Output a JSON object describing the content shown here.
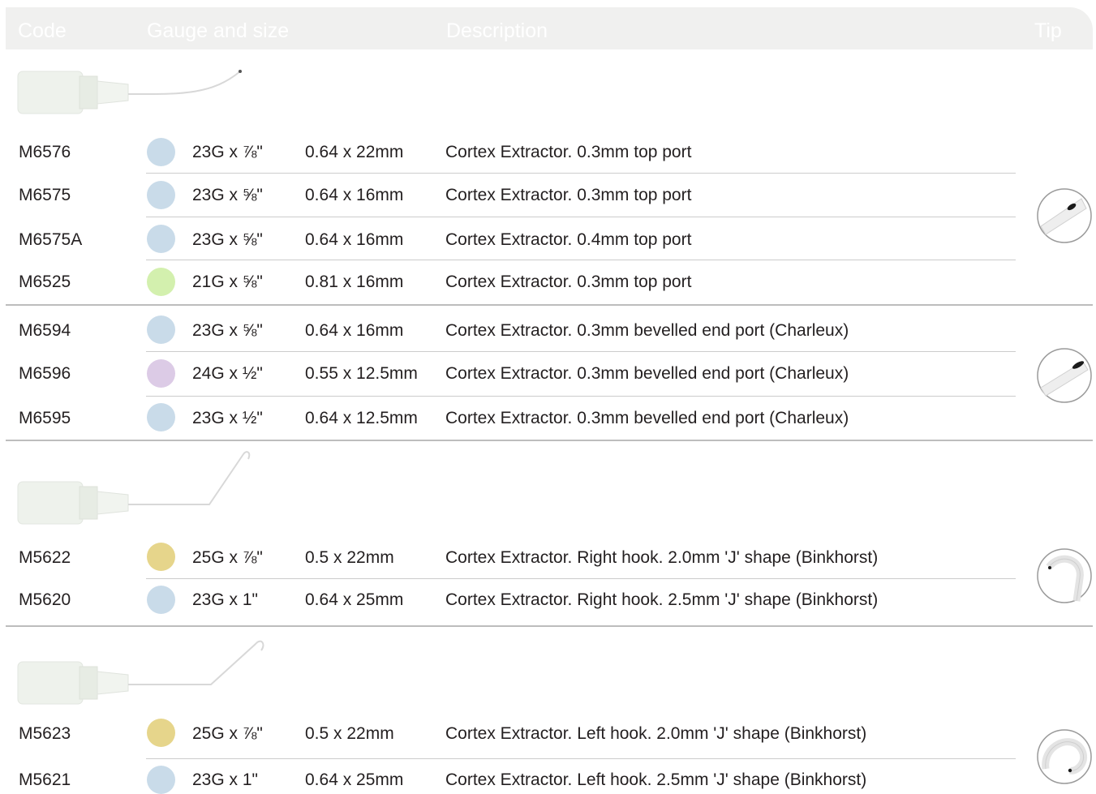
{
  "header": {
    "code": "Code",
    "gauge": "Gauge and size",
    "description": "Description",
    "tip": "Tip"
  },
  "colors": {
    "blue": "#c9dbe9",
    "green": "#d3f0ae",
    "lilac": "#dccbe6",
    "yellow": "#e6d58b",
    "header_bg": "#f0f0ef"
  },
  "groups": [
    {
      "rows": [
        {
          "code": "M6576",
          "gauge": "23G x ⅞\"",
          "size": "0.64 x 22mm",
          "description": "Cortex Extractor. 0.3mm top port",
          "color": "#c9dbe9"
        },
        {
          "code": "M6575",
          "gauge": "23G x ⅝\"",
          "size": "0.64 x 16mm",
          "description": "Cortex Extractor. 0.3mm top port",
          "color": "#c9dbe9"
        },
        {
          "code": "M6575A",
          "gauge": "23G x ⅝\"",
          "size": "0.64 x 16mm",
          "description": "Cortex Extractor. 0.4mm top port",
          "color": "#c9dbe9"
        },
        {
          "code": "M6525",
          "gauge": "21G x ⅝\"",
          "size": "0.81 x 16mm",
          "description": "Cortex Extractor. 0.3mm top port",
          "color": "#d3f0ae"
        }
      ]
    },
    {
      "rows": [
        {
          "code": "M6594",
          "gauge": "23G x ⅝\"",
          "size": "0.64 x 16mm",
          "description": "Cortex Extractor. 0.3mm bevelled end port (Charleux)",
          "color": "#c9dbe9"
        },
        {
          "code": "M6596",
          "gauge": "24G x ½\"",
          "size": "0.55 x 12.5mm",
          "description": "Cortex Extractor. 0.3mm bevelled end port (Charleux)",
          "color": "#dccbe6"
        },
        {
          "code": "M6595",
          "gauge": "23G x ½\"",
          "size": "0.64 x 12.5mm",
          "description": "Cortex Extractor. 0.3mm bevelled end port (Charleux)",
          "color": "#c9dbe9"
        }
      ]
    },
    {
      "rows": [
        {
          "code": "M5622",
          "gauge": "25G x ⅞\"",
          "size": "0.5 x 22mm",
          "description": "Cortex Extractor. Right hook. 2.0mm 'J' shape (Binkhorst)",
          "color": "#e6d58b"
        },
        {
          "code": "M5620",
          "gauge": "23G x 1\"",
          "size": "0.64 x 25mm",
          "description": "Cortex Extractor. Right hook. 2.5mm 'J' shape (Binkhorst)",
          "color": "#c9dbe9"
        }
      ]
    },
    {
      "rows": [
        {
          "code": "M5623",
          "gauge": "25G x ⅞\"",
          "size": "0.5 x 22mm",
          "description": "Cortex Extractor. Left hook. 2.0mm 'J' shape (Binkhorst)",
          "color": "#e6d58b"
        },
        {
          "code": "M5621",
          "gauge": "23G x 1\"",
          "size": "0.64 x 25mm",
          "description": "Cortex Extractor. Left hook. 2.5mm 'J' shape (Binkhorst)",
          "color": "#c9dbe9"
        }
      ]
    }
  ],
  "icons": {
    "cannula_curved": "cannula-curved-icon",
    "cannula_right_hook": "cannula-right-hook-icon",
    "cannula_left_hook": "cannula-left-hook-icon",
    "tip_top_port": "tip-top-port-icon",
    "tip_bevelled": "tip-bevelled-icon",
    "tip_hook_right": "tip-hook-right-icon",
    "tip_hook_left": "tip-hook-left-icon"
  }
}
